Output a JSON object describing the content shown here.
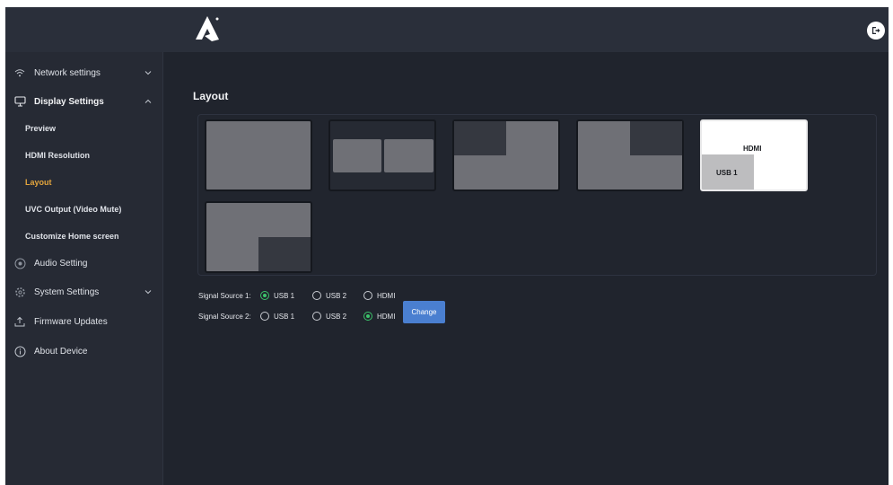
{
  "sidebar": {
    "network": "Network settings",
    "display": "Display Settings",
    "display_sub": [
      "Preview",
      "HDMI Resolution",
      "Layout",
      "UVC Output (Video Mute)",
      "Customize Home screen"
    ],
    "audio": "Audio Setting",
    "system": "System Settings",
    "firmware": "Firmware Updates",
    "about": "About Device",
    "active_item": "Layout"
  },
  "main": {
    "title": "Layout",
    "tiles": {
      "hdmi_label": "HDMI",
      "usb1_label": "USB 1"
    },
    "signal1": {
      "label": "Signal Source 1:",
      "options": [
        "USB 1",
        "USB 2",
        "HDMI"
      ],
      "selected": "USB 1"
    },
    "signal2": {
      "label": "Signal Source 2:",
      "options": [
        "USB 1",
        "USB 2",
        "HDMI"
      ],
      "selected": "HDMI"
    },
    "change_label": "Change"
  },
  "colors": {
    "accent_active": "#e3a53d",
    "radio_checked": "#3cc46b",
    "button": "#4a7fd0"
  },
  "icons": {
    "logo": "brand-logo-icon",
    "logout": "logout-icon",
    "network": "wifi-icon",
    "display": "monitor-icon",
    "audio": "audio-icon",
    "system": "gear-icon",
    "firmware": "upload-icon",
    "about": "info-icon"
  }
}
